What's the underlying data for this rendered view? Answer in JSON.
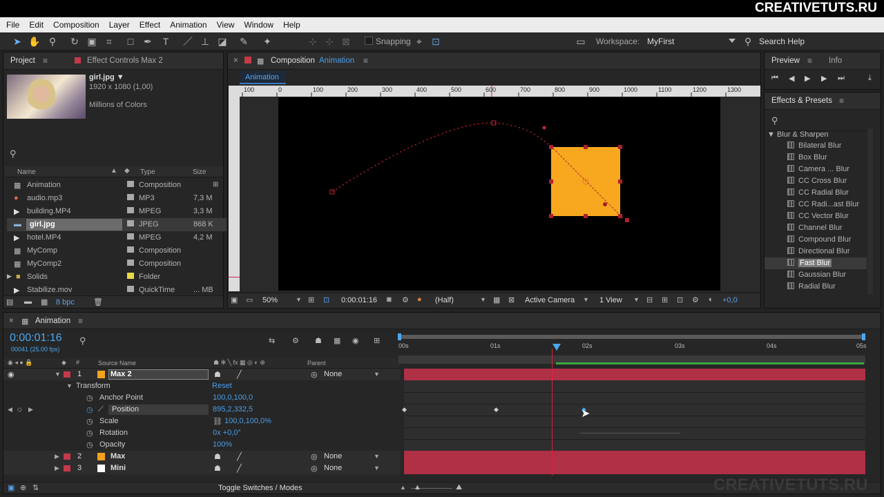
{
  "brand": "CREATIVETUTS.RU",
  "menu": [
    "File",
    "Edit",
    "Composition",
    "Layer",
    "Effect",
    "Animation",
    "View",
    "Window",
    "Help"
  ],
  "toolbar": {
    "snapping": "Snapping",
    "workspace_label": "Workspace:",
    "workspace_value": "MyFirst",
    "search_help": "Search Help"
  },
  "project": {
    "tab_project": "Project",
    "tab_effect_controls": "Effect Controls Max 2",
    "file_name": "girl.jpg ▼",
    "file_dims": "1920 x 1080 (1,00)",
    "file_colors": "Millions of Colors",
    "columns": {
      "name": "Name",
      "type": "Type",
      "size": "Size"
    },
    "items": [
      {
        "name": "Animation",
        "type": "Composition",
        "size": ""
      },
      {
        "name": "audio.mp3",
        "type": "MP3",
        "size": "7,3 M"
      },
      {
        "name": "building.MP4",
        "type": "MPEG",
        "size": "3,3 M"
      },
      {
        "name": "girl.jpg",
        "type": "JPEG",
        "size": "868 K"
      },
      {
        "name": "hotel.MP4",
        "type": "MPEG",
        "size": "4,2 M"
      },
      {
        "name": "MyComp",
        "type": "Composition",
        "size": ""
      },
      {
        "name": "MyComp2",
        "type": "Composition",
        "size": ""
      },
      {
        "name": "Solids",
        "type": "Folder",
        "size": ""
      },
      {
        "name": "Stabilize.mov",
        "type": "QuickTime",
        "size": "... MB"
      }
    ],
    "bpc": "8 bpc"
  },
  "composition": {
    "tab_label": "Composition",
    "tab_name": "Animation",
    "sub_tab": "Animation",
    "ruler": [
      "100",
      "0",
      "100",
      "200",
      "300",
      "400",
      "500",
      "600",
      "700",
      "800",
      "900",
      "1000",
      "1100",
      "1200",
      "1300"
    ],
    "zoom": "50%",
    "timecode": "0:00:01:16",
    "resolution": "(Half)",
    "camera": "Active Camera",
    "views": "1 View",
    "exposure": "+0,0"
  },
  "preview": {
    "tab_preview": "Preview",
    "tab_info": "Info"
  },
  "effects": {
    "title": "Effects & Presets",
    "category": "▼ Blur & Sharpen",
    "items": [
      "Bilateral Blur",
      "Box Blur",
      "Camera ... Blur",
      "CC Cross Blur",
      "CC Radial Blur",
      "CC Radi...ast Blur",
      "CC Vector Blur",
      "Channel Blur",
      "Compound Blur",
      "Directional Blur",
      "Fast Blur",
      "Gaussian Blur",
      "Radial Blur"
    ]
  },
  "timeline": {
    "tab": "Animation",
    "timecode": "0:00:01:16",
    "frames": "00041 (25.00 fps)",
    "source_name_col": "Source Name",
    "parent_col": "Parent",
    "time_ticks": [
      "00s",
      "01s",
      "02s",
      "03s",
      "04s",
      "05s"
    ],
    "layers": [
      {
        "num": "1",
        "name": "Max 2",
        "parent": "None",
        "color": "#f2a21d"
      },
      {
        "num": "2",
        "name": "Max",
        "parent": "None",
        "color": "#f2a21d"
      },
      {
        "num": "3",
        "name": "Mini",
        "parent": "None",
        "color": "#ffffff"
      }
    ],
    "transform": "Transform",
    "reset": "Reset",
    "props": [
      {
        "name": "Anchor Point",
        "value": "100,0,100,0"
      },
      {
        "name": "Position",
        "value": "895,2,332,5"
      },
      {
        "name": "Scale",
        "value": "100,0,100,0%"
      },
      {
        "name": "Rotation",
        "value": "0x +0,0°"
      },
      {
        "name": "Opacity",
        "value": "100%"
      }
    ],
    "toggle": "Toggle Switches / Modes",
    "watermark": "CREATIVETUTS.RU"
  }
}
